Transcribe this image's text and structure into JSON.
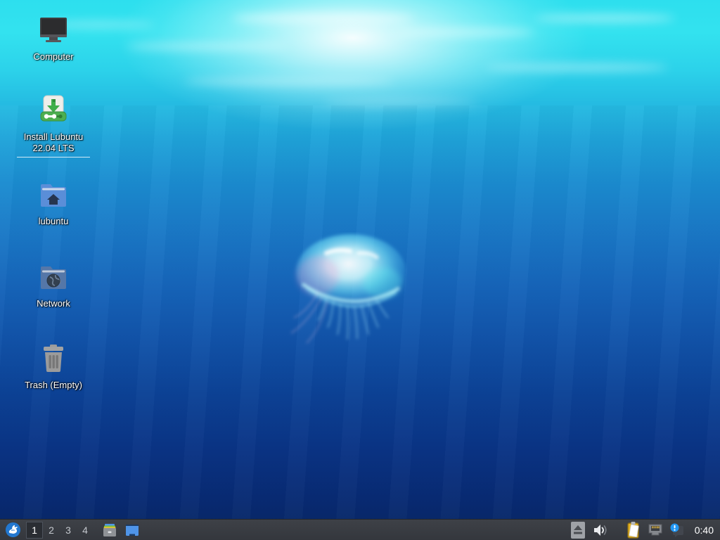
{
  "desktop": {
    "icons": [
      {
        "label": "Computer"
      },
      {
        "label": "Install Lubuntu 22.04 LTS"
      },
      {
        "label": "lubuntu"
      },
      {
        "label": "Network"
      },
      {
        "label": "Trash (Empty)"
      }
    ]
  },
  "taskbar": {
    "workspaces": [
      {
        "label": "1",
        "active": true
      },
      {
        "label": "2",
        "active": false
      },
      {
        "label": "3",
        "active": false
      },
      {
        "label": "4",
        "active": false
      }
    ],
    "clock": "0:40"
  },
  "colors": {
    "panel": "#383b41",
    "logo_blue": "#2277cf",
    "folder_blue": "#5a8ed8",
    "installer_green": "#4caf50",
    "clipboard_yellow": "#e6b422",
    "notification_blue": "#2196f3",
    "wallpaper_top": "#2ddfee",
    "wallpaper_bottom": "#07265f"
  }
}
